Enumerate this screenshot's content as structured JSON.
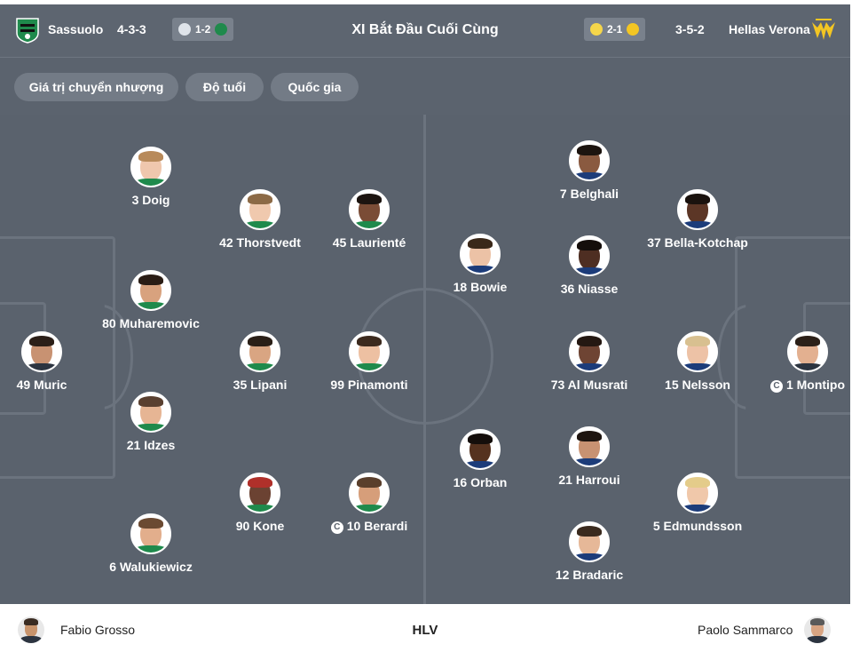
{
  "header": {
    "title": "XI Bắt Đầu Cuối Cùng",
    "home": {
      "name": "Sassuolo",
      "formation": "4-3-3",
      "color": "#1f8a4c",
      "previous_result": "1-2"
    },
    "away": {
      "name": "Hellas Verona",
      "formation": "3-5-2",
      "color": "#f3c623",
      "previous_result": "2-1"
    }
  },
  "filters": [
    "Giá trị chuyển nhượng",
    "Độ tuổi",
    "Quốc gia"
  ],
  "home_players": [
    {
      "label": "49 Muric",
      "captain": false
    },
    {
      "label": "3 Doig",
      "captain": false
    },
    {
      "label": "80 Muharemovic",
      "captain": false
    },
    {
      "label": "21 Idzes",
      "captain": false
    },
    {
      "label": "6 Walukiewicz",
      "captain": false
    },
    {
      "label": "42 Thorstvedt",
      "captain": false
    },
    {
      "label": "35 Lipani",
      "captain": false
    },
    {
      "label": "90 Kone",
      "captain": false
    },
    {
      "label": "45 Laurienté",
      "captain": false
    },
    {
      "label": "99 Pinamonti",
      "captain": false
    },
    {
      "label": "10 Berardi",
      "captain": true
    }
  ],
  "away_players": [
    {
      "label": "1 Montipo",
      "captain": true
    },
    {
      "label": "37 Bella-Kotchap",
      "captain": false
    },
    {
      "label": "15 Nelsson",
      "captain": false
    },
    {
      "label": "5 Edmundsson",
      "captain": false
    },
    {
      "label": "7 Belghali",
      "captain": false
    },
    {
      "label": "36 Niasse",
      "captain": false
    },
    {
      "label": "73 Al Musrati",
      "captain": false
    },
    {
      "label": "21 Harroui",
      "captain": false
    },
    {
      "label": "12 Bradaric",
      "captain": false
    },
    {
      "label": "18 Bowie",
      "captain": false
    },
    {
      "label": "16 Orban",
      "captain": false
    }
  ],
  "coaches": {
    "label": "HLV",
    "home": "Fabio Grosso",
    "away": "Paolo Sammarco"
  }
}
